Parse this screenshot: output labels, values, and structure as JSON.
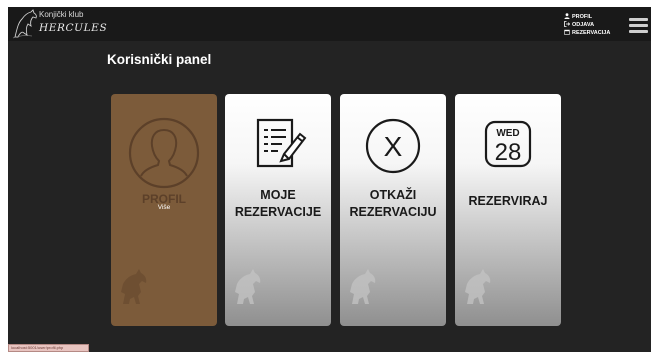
{
  "header": {
    "logo_small": "Konjički klub",
    "logo_big": "HERCULES",
    "menu": [
      {
        "label": "PROFIL",
        "icon": "user-icon"
      },
      {
        "label": "ODJAVA",
        "icon": "logout-icon"
      },
      {
        "label": "REZERVACIJA",
        "icon": "calendar-icon"
      }
    ]
  },
  "main": {
    "title": "Korisnički panel",
    "cards": [
      {
        "label": "PROFIL",
        "sublabel": "Više",
        "icon": "user-circle-icon",
        "state": "hovered"
      },
      {
        "label_line1": "MOJE",
        "label_line2": "REZERVACIJE",
        "icon": "edit-document-icon"
      },
      {
        "label_line1": "OTKAŽI",
        "label_line2": "REZERVACIJU",
        "icon": "cancel-circle-icon",
        "glyph": "X"
      },
      {
        "label": "REZERVIRAJ",
        "icon": "calendar-day-icon",
        "day_name": "WED",
        "day_num": "28"
      }
    ]
  },
  "status_bar": {
    "text": "localhost:5001/user/profil.php"
  },
  "colors": {
    "background": "#232323",
    "topbar": "#191919",
    "card_hover": "#7c5b3a",
    "card_light": "#ffffff"
  }
}
